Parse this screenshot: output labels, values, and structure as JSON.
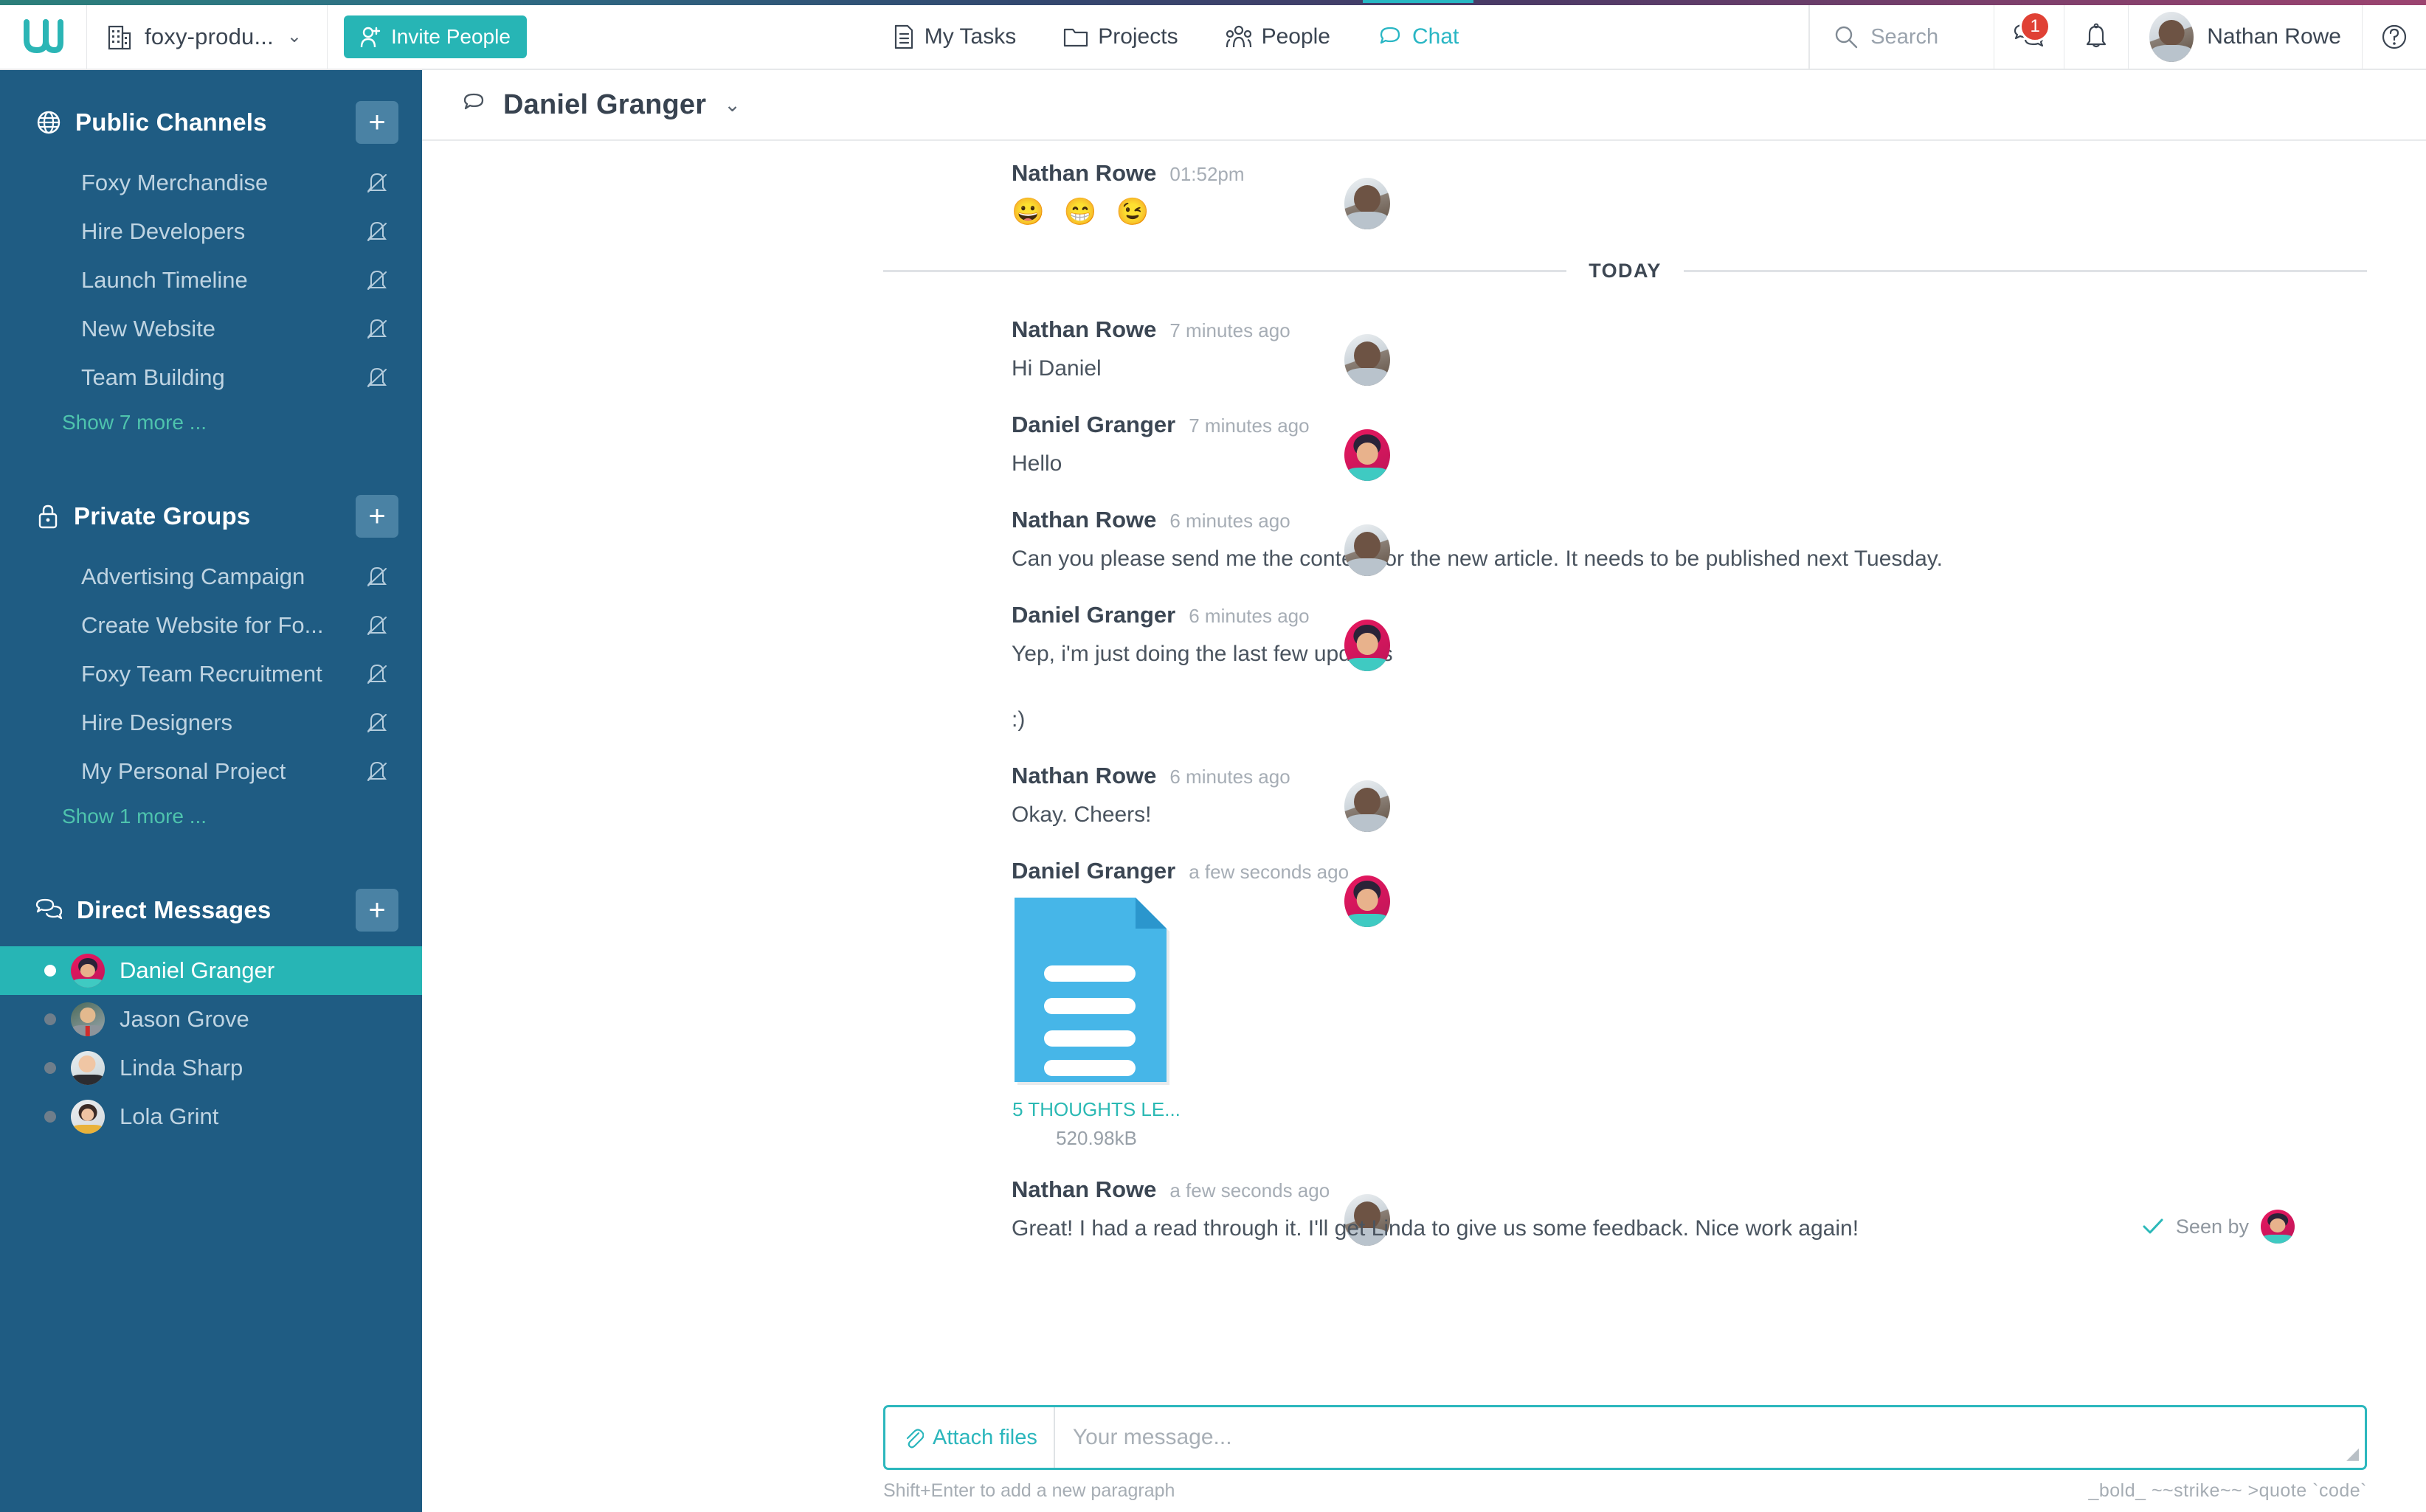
{
  "topbar": {
    "logo_icon": "teamwork-logo-icon",
    "project_selector": {
      "label": "foxy-produ...",
      "icon": "building-icon",
      "chevron": "chevron-down-icon"
    },
    "invite_button": {
      "label": "Invite People",
      "icon": "add-person-icon"
    },
    "nav_items": [
      {
        "label": "My Tasks",
        "icon": "tasks-document-icon",
        "active": false
      },
      {
        "label": "Projects",
        "icon": "folder-icon",
        "active": false
      },
      {
        "label": "People",
        "icon": "people-icon",
        "active": false
      },
      {
        "label": "Chat",
        "icon": "chat-bubble-icon",
        "active": true
      }
    ],
    "search": {
      "placeholder": "Search",
      "icon": "search-icon"
    },
    "messages": {
      "icon": "chat-bubbles-icon",
      "badge": "1"
    },
    "notifications": {
      "icon": "bell-icon"
    },
    "user": {
      "name": "Nathan Rowe",
      "avatar": "nathan-avatar"
    },
    "help": {
      "icon": "question-circle-icon"
    },
    "accent_color": "#27b5b5",
    "badge_color": "#e04135"
  },
  "sidebar": {
    "background_color": "#1f5c83",
    "active_color": "#27b5b5",
    "sections": [
      {
        "title": "Public Channels",
        "icon": "globe-icon",
        "add_button": "+",
        "items": [
          {
            "label": "Foxy Merchandise",
            "muted_icon": "bell-muted-icon"
          },
          {
            "label": "Hire Developers",
            "muted_icon": "bell-muted-icon"
          },
          {
            "label": "Launch Timeline",
            "muted_icon": "bell-muted-icon"
          },
          {
            "label": "New Website",
            "muted_icon": "bell-muted-icon"
          },
          {
            "label": "Team Building",
            "muted_icon": "bell-muted-icon"
          }
        ],
        "show_more": "Show 7 more ..."
      },
      {
        "title": "Private Groups",
        "icon": "lock-icon",
        "add_button": "+",
        "items": [
          {
            "label": "Advertising Campaign",
            "muted_icon": "bell-muted-icon"
          },
          {
            "label": "Create Website for Fo...",
            "muted_icon": "bell-muted-icon"
          },
          {
            "label": "Foxy Team Recruitment",
            "muted_icon": "bell-muted-icon"
          },
          {
            "label": "Hire Designers",
            "muted_icon": "bell-muted-icon"
          },
          {
            "label": "My Personal Project",
            "muted_icon": "bell-muted-icon"
          }
        ],
        "show_more": "Show 1 more ..."
      }
    ],
    "direct_messages": {
      "title": "Direct Messages",
      "icon": "chat-bubbles-icon",
      "add_button": "+",
      "items": [
        {
          "name": "Daniel Granger",
          "online": true,
          "active": true
        },
        {
          "name": "Jason Grove",
          "online": false,
          "active": false
        },
        {
          "name": "Linda Sharp",
          "online": false,
          "active": false
        },
        {
          "name": "Lola Grint",
          "online": false,
          "active": false
        }
      ]
    }
  },
  "chat": {
    "header": {
      "title": "Daniel Granger",
      "icon": "chat-bubble-icon",
      "chevron": "chevron-down-icon"
    },
    "day_divider": "TODAY",
    "messages": [
      {
        "author": "Nathan Rowe",
        "time": "01:52pm",
        "avatar": "nathan-avatar",
        "type": "emoji",
        "text": "😀 😁 😉"
      },
      {
        "author": "Nathan Rowe",
        "time": "7 minutes ago",
        "avatar": "nathan-avatar",
        "type": "text",
        "text": "Hi Daniel"
      },
      {
        "author": "Daniel Granger",
        "time": "7 minutes ago",
        "avatar": "daniel-avatar",
        "type": "text",
        "text": "Hello"
      },
      {
        "author": "Nathan Rowe",
        "time": "6 minutes ago",
        "avatar": "nathan-avatar",
        "type": "text",
        "text": "Can you please send me the content for the new article. It needs to be published next Tuesday."
      },
      {
        "author": "Daniel Granger",
        "time": "6 minutes ago",
        "avatar": "daniel-avatar",
        "type": "text2",
        "text": "Yep, i'm just doing the last few updates",
        "text2": ":)"
      },
      {
        "author": "Nathan Rowe",
        "time": "6 minutes ago",
        "avatar": "nathan-avatar",
        "type": "text",
        "text": "Okay. Cheers!"
      },
      {
        "author": "Daniel Granger",
        "time": "a few seconds ago",
        "avatar": "daniel-avatar",
        "type": "file",
        "file": {
          "name": "5 THOUGHTS LE...",
          "size": "520.98kB",
          "icon": "document-file-icon",
          "color": "#46b6e8"
        }
      },
      {
        "author": "Nathan Rowe",
        "time": "a few seconds ago",
        "avatar": "nathan-avatar",
        "type": "text",
        "text": "Great! I had a read through it. I'll get Linda to give us some feedback. Nice work again!",
        "seen_by": {
          "label": "Seen by",
          "check_icon": "check-icon",
          "avatar": "daniel-avatar"
        }
      }
    ],
    "composer": {
      "attach_label": "Attach files",
      "attach_icon": "paperclip-icon",
      "placeholder": "Your message...",
      "value": "",
      "hint": "Shift+Enter to add a new paragraph",
      "formatting_hint": "_bold_  ~~strike~~  >quote  `code`",
      "border_color": "#2cb7bd"
    }
  }
}
